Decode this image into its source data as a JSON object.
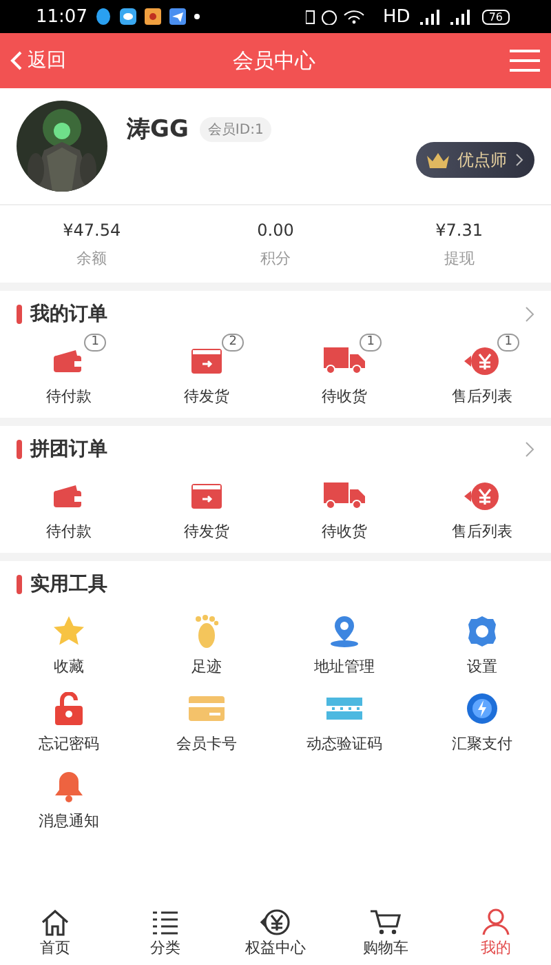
{
  "status_bar": {
    "time": "11:07",
    "network": "HD",
    "battery": "76"
  },
  "header": {
    "back": "返回",
    "title": "会员中心"
  },
  "profile": {
    "name": "涛GG",
    "member_id": "会员ID:1",
    "level_badge": "优点师"
  },
  "stats": [
    {
      "value": "¥47.54",
      "label": "余额"
    },
    {
      "value": "0.00",
      "label": "积分"
    },
    {
      "value": "¥7.31",
      "label": "提现"
    }
  ],
  "sections": [
    {
      "title": "我的订单",
      "items": [
        {
          "kind": "wallet",
          "label": "待付款",
          "count": "1"
        },
        {
          "kind": "box",
          "label": "待发货",
          "count": "2"
        },
        {
          "kind": "truck",
          "label": "待收货",
          "count": "1"
        },
        {
          "kind": "refund",
          "label": "售后列表",
          "count": "1"
        }
      ]
    },
    {
      "title": "拼团订单",
      "items": [
        {
          "kind": "wallet",
          "label": "待付款"
        },
        {
          "kind": "box",
          "label": "待发货"
        },
        {
          "kind": "truck",
          "label": "待收货"
        },
        {
          "kind": "refund",
          "label": "售后列表"
        }
      ]
    }
  ],
  "tools": {
    "title": "实用工具",
    "items": [
      {
        "kind": "star",
        "label": "收藏"
      },
      {
        "kind": "foot",
        "label": "足迹"
      },
      {
        "kind": "pin",
        "label": "地址管理"
      },
      {
        "kind": "gear",
        "label": "设置"
      },
      {
        "kind": "lock",
        "label": "忘记密码"
      },
      {
        "kind": "card",
        "label": "会员卡号"
      },
      {
        "kind": "code",
        "label": "动态验证码"
      },
      {
        "kind": "pay",
        "label": "汇聚支付"
      },
      {
        "kind": "bell",
        "label": "消息通知"
      }
    ]
  },
  "tab_bar": [
    {
      "kind": "home",
      "label": "首页",
      "selected": false
    },
    {
      "kind": "list",
      "label": "分类",
      "selected": false
    },
    {
      "kind": "yen",
      "label": "权益中心",
      "selected": false
    },
    {
      "kind": "cart",
      "label": "购物车",
      "selected": false
    },
    {
      "kind": "user",
      "label": "我的",
      "selected": true
    }
  ]
}
